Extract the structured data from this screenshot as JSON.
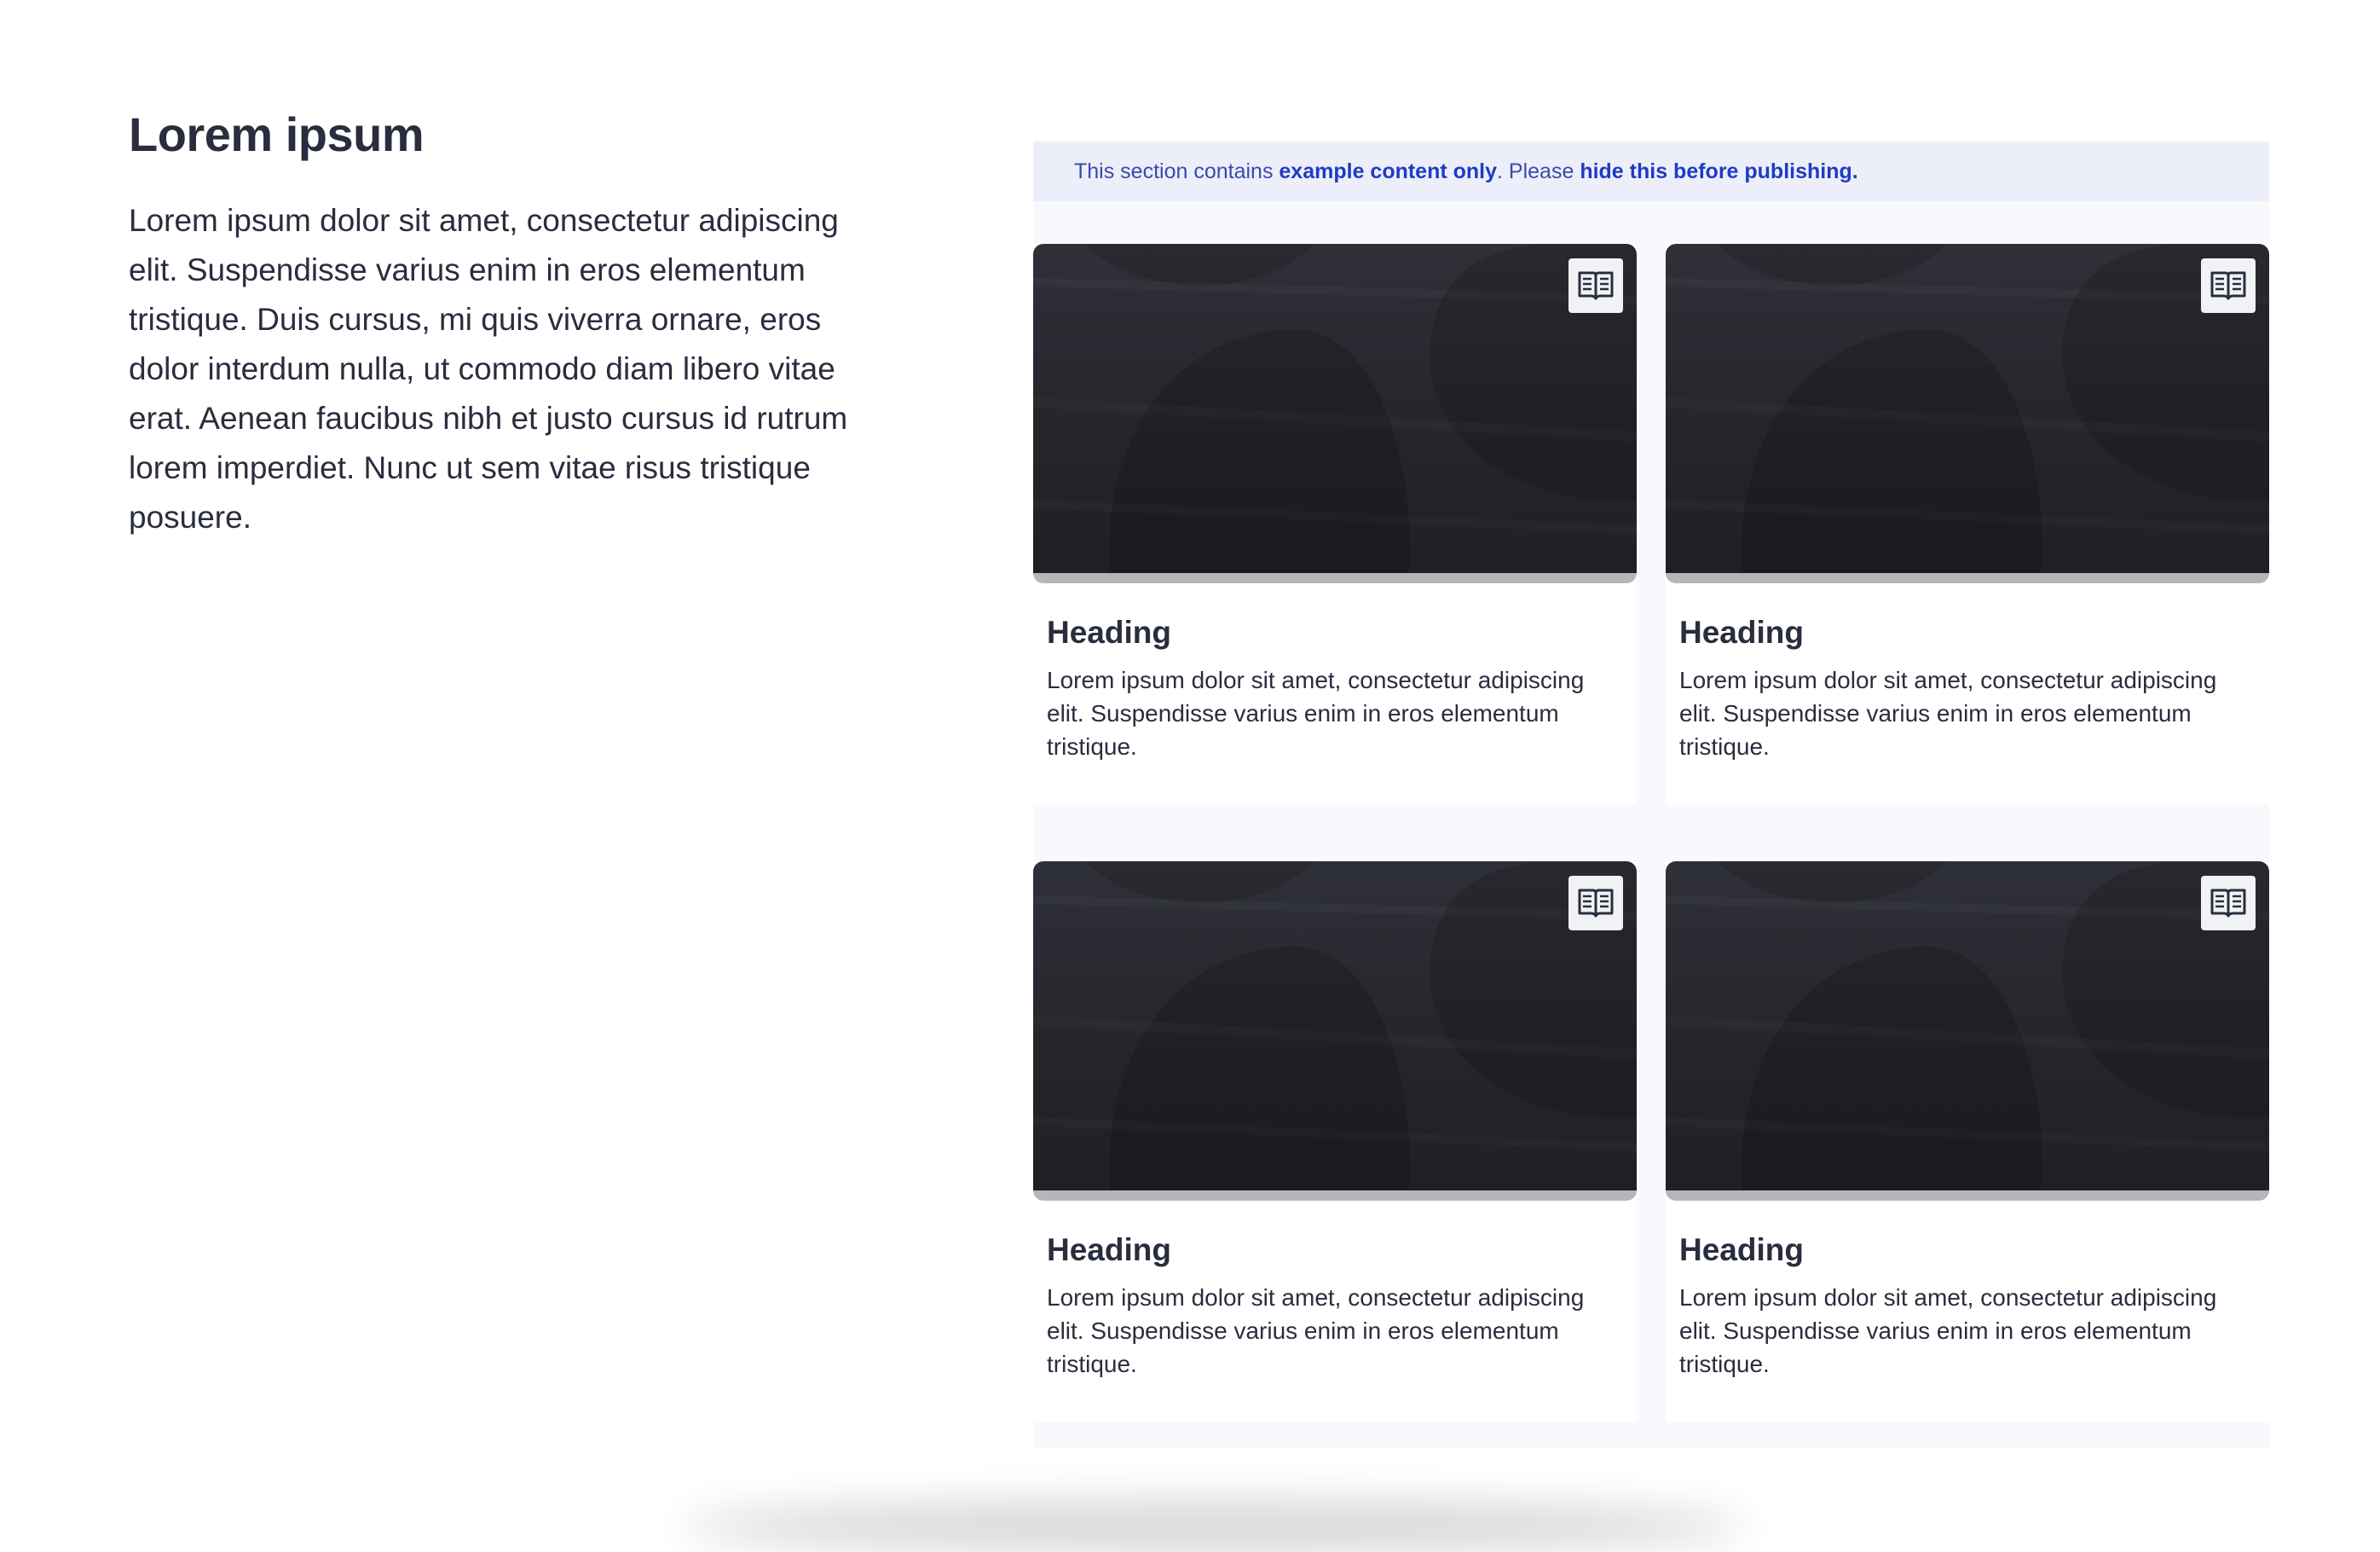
{
  "intro": {
    "title": "Lorem ipsum",
    "body": "Lorem ipsum dolor sit amet, consectetur adipiscing elit. Suspendisse varius enim in eros elementum tristique. Duis cursus, mi quis viverra ornare, eros dolor interdum nulla, ut commodo diam libero vitae erat. Aenean faucibus nibh et justo cursus id rutrum lorem imperdiet. Nunc ut sem vitae risus tristique posuere."
  },
  "notice": {
    "prefix": "This section contains ",
    "emphasis1": "example content only",
    "middle": ". Please ",
    "emphasis2": "hide this before publishing."
  },
  "cards": [
    {
      "heading": "Heading",
      "text": "Lorem ipsum dolor sit amet, consectetur adipiscing elit. Suspendisse varius enim in eros elementum tristique.",
      "icon": "book-icon"
    },
    {
      "heading": "Heading",
      "text": "Lorem ipsum dolor sit amet, consectetur adipiscing elit. Suspendisse varius enim in eros elementum tristique.",
      "icon": "book-icon"
    },
    {
      "heading": "Heading",
      "text": "Lorem ipsum dolor sit amet, consectetur adipiscing elit. Suspendisse varius enim in eros elementum tristique.",
      "icon": "book-icon"
    },
    {
      "heading": "Heading",
      "text": "Lorem ipsum dolor sit amet, consectetur adipiscing elit. Suspendisse varius enim in eros elementum tristique.",
      "icon": "book-icon"
    }
  ],
  "colors": {
    "text": "#2a2d3e",
    "notice_background": "#eceffa",
    "notice_text": "#3a4aa8",
    "notice_emphasis": "#1f3bc4",
    "panel_background": "#f8f9fc",
    "image_dark": "#25262c"
  }
}
